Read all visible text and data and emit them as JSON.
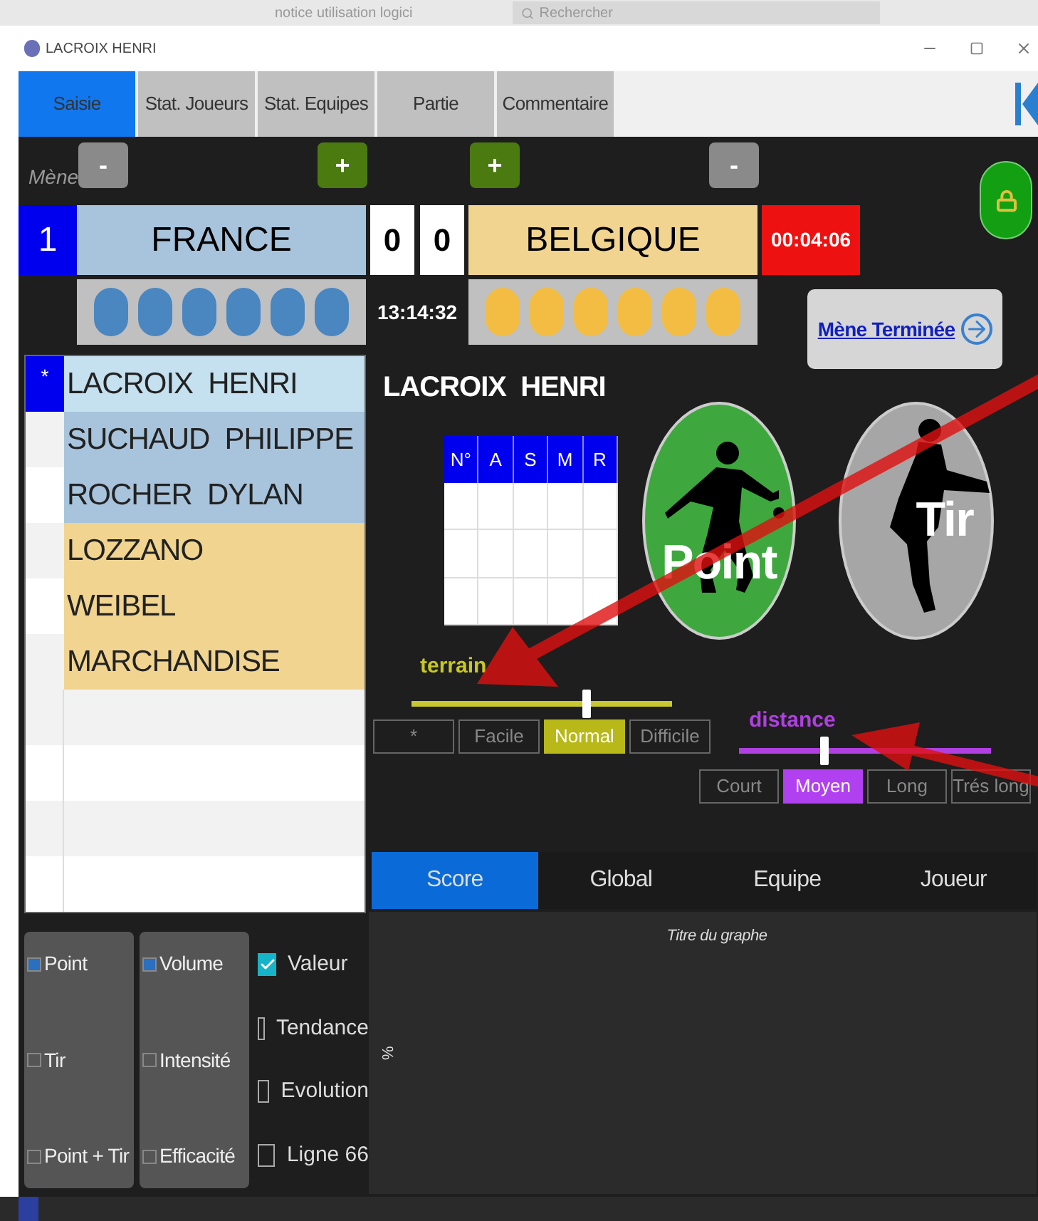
{
  "background_app": {
    "document_title": "notice utilisation logici",
    "search_placeholder": "Rechercher"
  },
  "window": {
    "title": "LACROIX  HENRI"
  },
  "tabs": [
    {
      "label": "Saisie",
      "selected": true
    },
    {
      "label": "Stat. Joueurs",
      "selected": false
    },
    {
      "label": "Stat. Equipes",
      "selected": false
    },
    {
      "label": "Partie",
      "selected": false
    },
    {
      "label": "Commentaire",
      "selected": false
    }
  ],
  "mene": {
    "label": "Mène",
    "number": "1",
    "left_minus": "-",
    "left_plus": "+",
    "right_plus": "+",
    "right_minus": "-"
  },
  "teams": [
    {
      "name": "FRANCE",
      "score": "0",
      "color": "#a8c4dc",
      "balls": {
        "color": "#4a86c0"
      }
    },
    {
      "name": "BELGIQUE",
      "score": "0",
      "color": "#f0d490",
      "balls": {
        "color": "#f2bd42"
      }
    }
  ],
  "timer": "00:04:06",
  "clock": "13:14:32",
  "end_button": "Mène Terminée",
  "players": [
    {
      "name": "LACROIX  HENRI",
      "marker": "*",
      "selected": true,
      "color": "#c5e0ee"
    },
    {
      "name": "SUCHAUD  PHILIPPE",
      "selected": false,
      "color": "#a8c4dc"
    },
    {
      "name": "ROCHER  DYLAN",
      "selected": false,
      "color": "#a8c4dc"
    },
    {
      "name": "LOZZANO",
      "selected": false,
      "color": "#f0d490"
    },
    {
      "name": "WEIBEL",
      "selected": false,
      "color": "#f0d490"
    },
    {
      "name": "MARCHANDISE",
      "selected": false,
      "color": "#f0d490"
    }
  ],
  "current_player": "LACROIX  HENRI",
  "shot_table": {
    "columns": [
      "N°",
      "A",
      "S",
      "M",
      "R"
    ]
  },
  "shot_buttons": [
    {
      "label": "Point",
      "kind": "point"
    },
    {
      "label": "Tir",
      "kind": "tir"
    }
  ],
  "terrain": {
    "label": "terrain",
    "level": 0.67,
    "options": [
      {
        "label": "*",
        "selected": false
      },
      {
        "label": "Facile",
        "selected": false
      },
      {
        "label": "Normal",
        "selected": true
      },
      {
        "label": "Difficile",
        "selected": false
      }
    ]
  },
  "distance": {
    "label": "distance",
    "level": 0.34,
    "options": [
      {
        "label": "Court",
        "selected": false
      },
      {
        "label": "Moyen",
        "selected": true
      },
      {
        "label": "Long",
        "selected": false
      },
      {
        "label": "Trés long",
        "selected": false
      }
    ]
  },
  "stats_tabs": [
    {
      "label": "Score",
      "selected": true
    },
    {
      "label": "Global",
      "selected": false
    },
    {
      "label": "Equipe",
      "selected": false
    },
    {
      "label": "Joueur",
      "selected": false
    }
  ],
  "chart": {
    "title": "Titre du graphe",
    "ylabel": "%"
  },
  "filters": [
    {
      "kind": "panel",
      "items": [
        {
          "label": "Point",
          "checked": true
        },
        {
          "label": "Tir",
          "checked": false
        },
        {
          "label": "Point + Tir",
          "checked": false
        }
      ]
    },
    {
      "kind": "panel",
      "items": [
        {
          "label": "Volume",
          "checked": true
        },
        {
          "label": "Intensité",
          "checked": false
        },
        {
          "label": "Efficacité",
          "checked": false
        }
      ]
    },
    {
      "kind": "plain",
      "items": [
        {
          "label": "Valeur",
          "checked": true
        },
        {
          "label": "Tendance",
          "checked": false
        },
        {
          "label": "Evolution",
          "checked": false
        },
        {
          "label": "Ligne 66",
          "checked": false
        }
      ]
    }
  ]
}
